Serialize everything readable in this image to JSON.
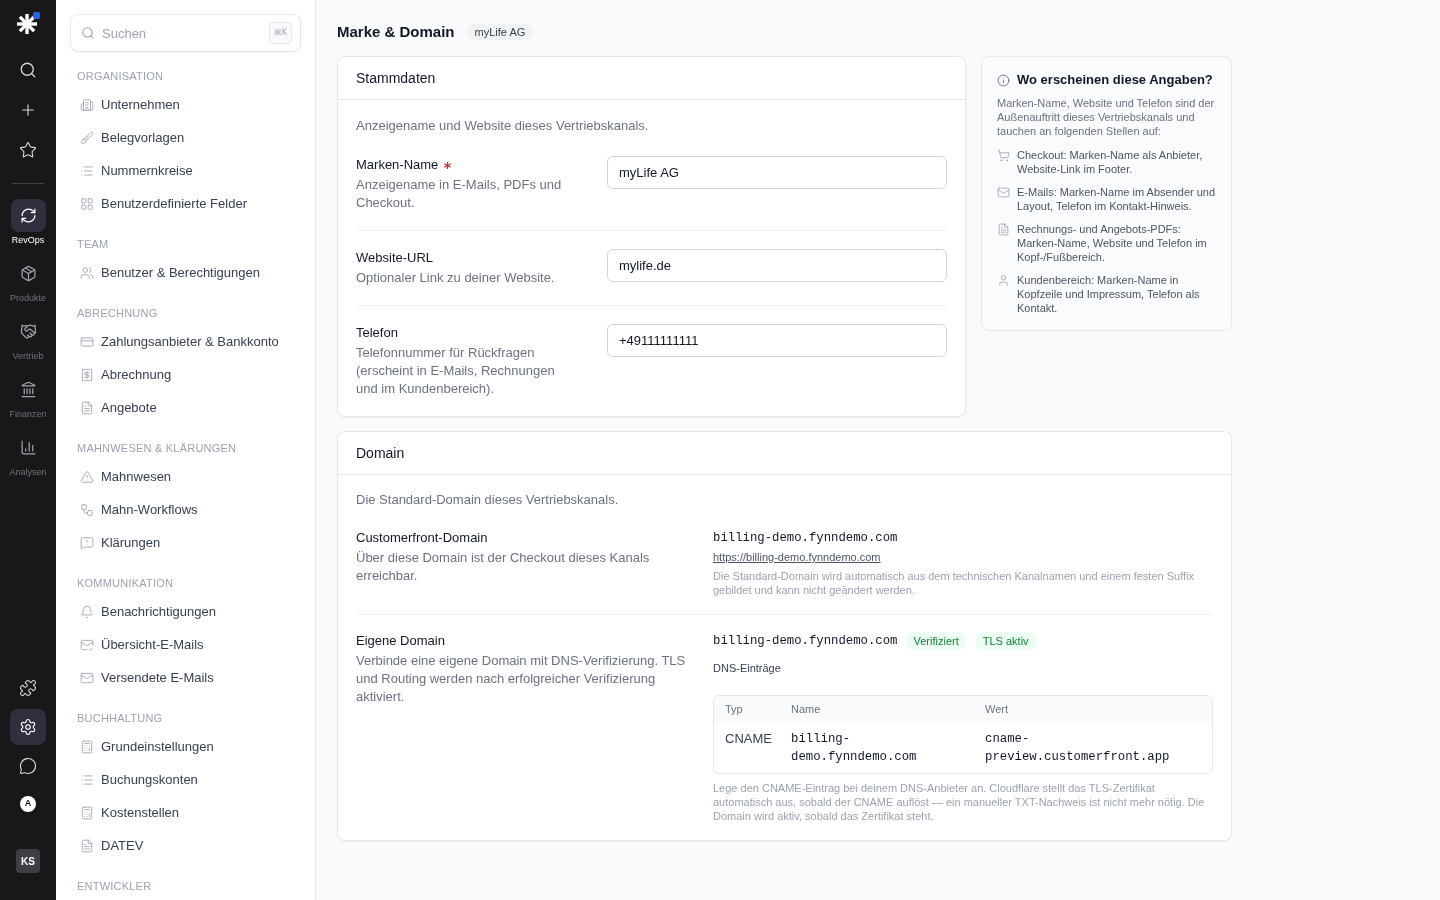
{
  "rail": {
    "nav": [
      {
        "label": "RevOps",
        "selected": true
      },
      {
        "label": "Produkte",
        "selected": false
      },
      {
        "label": "Vertrieb",
        "selected": false
      },
      {
        "label": "Finanzen",
        "selected": false
      },
      {
        "label": "Analysen",
        "selected": false
      }
    ],
    "tools": [
      {
        "selected": false
      },
      {
        "selected": true
      },
      {
        "selected": false
      }
    ],
    "account_badge": "A",
    "user_initials": "KS"
  },
  "sidebar": {
    "search": {
      "placeholder": "Suchen",
      "shortcut": "⌘K"
    },
    "sections": [
      {
        "title": "ORGANISATION",
        "items": [
          "Unternehmen",
          "Belegvorlagen",
          "Nummernkreise",
          "Benutzerdefinierte Felder"
        ]
      },
      {
        "title": "TEAM",
        "items": [
          "Benutzer & Berechtigungen"
        ]
      },
      {
        "title": "ABRECHNUNG",
        "items": [
          "Zahlungsanbieter & Bankkonto",
          "Abrechnung",
          "Angebote"
        ]
      },
      {
        "title": "MAHNWESEN & KLÄRUNGEN",
        "items": [
          "Mahnwesen",
          "Mahn-Workflows",
          "Klärungen"
        ]
      },
      {
        "title": "KOMMUNIKATION",
        "items": [
          "Benachrichtigungen",
          "Übersicht-E-Mails",
          "Versendete E-Mails"
        ]
      },
      {
        "title": "BUCHHALTUNG",
        "items": [
          "Grundeinstellungen",
          "Buchungskonten",
          "Kostenstellen",
          "DATEV"
        ]
      },
      {
        "title": "ENTWICKLER"
      }
    ]
  },
  "page": {
    "title": "Marke & Domain",
    "badge": "myLife AG"
  },
  "stammdaten": {
    "title": "Stammdaten",
    "description": "Anzeigename und Website dieses Vertriebskanals.",
    "fields": [
      {
        "label": "Marken-Name",
        "required": true,
        "hint": "Anzeigename in E-Mails, PDFs und Checkout.",
        "value": "myLife AG"
      },
      {
        "label": "Website-URL",
        "required": false,
        "hint": "Optionaler Link zu deiner Website.",
        "value": "mylife.de"
      },
      {
        "label": "Telefon",
        "required": false,
        "hint": "Telefonnummer für Rückfragen (erscheint in E-Mails, Rechnungen und im Kundenbereich).",
        "value": "+49111111111"
      }
    ]
  },
  "info": {
    "title": "Wo erscheinen diese Angaben?",
    "intro": "Marken-Name, Website und Telefon sind der Außenauftritt dieses Vertriebskanals und tauchen an folgenden Stellen auf:",
    "items": [
      "Checkout: Marken-Name als Anbieter, Website-Link im Footer.",
      "E-Mails: Marken-Name im Absender und Layout, Telefon im Kontakt-Hinweis.",
      "Rechnungs- und Angebots-PDFs: Marken-Name, Website und Telefon im Kopf-/Fußbereich.",
      "Kundenbereich: Marken-Name in Kopfzeile und Impressum, Telefon als Kontakt."
    ]
  },
  "domain": {
    "title": "Domain",
    "description": "Die Standard-Domain dieses Vertriebskanals.",
    "customerfront": {
      "label": "Customerfront-Domain",
      "hint": "Über diese Domain ist der Checkout dieses Kanals erreichbar.",
      "domain": "billing-demo.fynndemo.com",
      "link": "https://billing-demo.fynndemo.com",
      "note": "Die Standard-Domain wird automatisch aus dem technischen Kanalnamen und einem festen Suffix gebildet und kann nicht geändert werden."
    },
    "custom": {
      "label": "Eigene Domain",
      "hint": "Verbinde eine eigene Domain mit DNS-Verifizierung. TLS und Routing werden nach erfolgreicher Verifizierung aktiviert.",
      "domain": "billing-demo.fynndemo.com",
      "badges": [
        "Verifiziert",
        "TLS aktiv"
      ],
      "dns_title": "DNS-Einträge",
      "dns_table": {
        "columns": [
          "Typ",
          "Name",
          "Wert"
        ],
        "rows": [
          [
            "CNAME",
            "billing-demo.fynndemo.com",
            "cname-preview.customerfront.app"
          ]
        ]
      },
      "note": "Lege den CNAME-Eintrag bei deinem DNS-Anbieter an. Cloudflare stellt das TLS-Zertifikat automatisch aus, sobald der CNAME auflöst — ein manueller TXT-Nachweis ist nicht mehr nötig. Die Domain wird aktiv, sobald das Zertifikat steht."
    }
  }
}
